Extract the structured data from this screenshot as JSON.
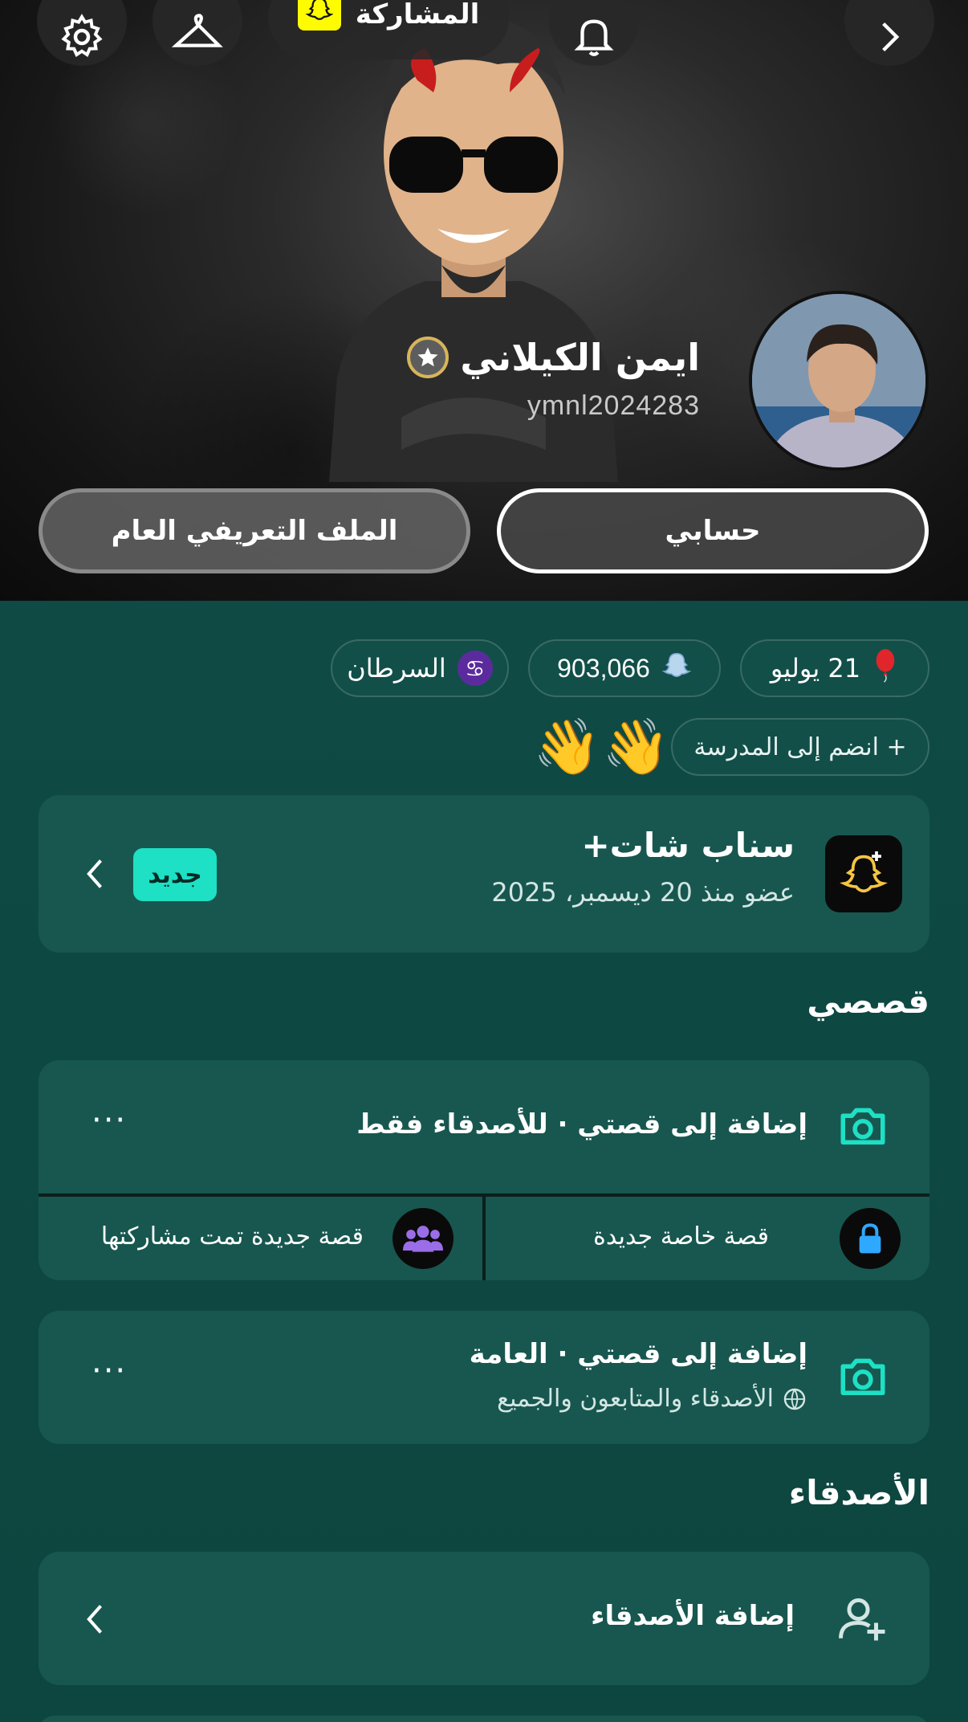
{
  "topbar": {
    "share_label": "المشاركة",
    "icons": [
      "settings-icon",
      "outfit-hanger-icon",
      "snapcode-icon",
      "notification-bell-icon",
      "chevron-right-icon"
    ]
  },
  "profile": {
    "display_name": "ايمن الكيلاني",
    "username": "ymnl2024283"
  },
  "hero_buttons": {
    "my_account": "حسابي",
    "public_profile": "الملف التعريفي العام"
  },
  "chips": {
    "birthday": "21 يوليو",
    "snap_score": "903,066",
    "zodiac": "السرطان",
    "join_school": "+ انضم إلى المدرسة"
  },
  "snapchat_plus": {
    "title": "سناب شات+",
    "subtitle": "عضو منذ 20 ديسمبر، 2025",
    "badge": "جديد"
  },
  "stories_section": {
    "title": "قصصي",
    "friends_only": "إضافة إلى قصتي · للأصدقاء فقط",
    "new_private_story": "قصة خاصة جديدة",
    "new_shared_story": "قصة جديدة تمت مشاركتها",
    "public_story": "إضافة إلى قصتي · العامة",
    "public_story_sub": "الأصدقاء والمتابعون والجميع"
  },
  "friends_section": {
    "title": "الأصدقاء",
    "add_friends": "إضافة الأصدقاء"
  },
  "colors": {
    "teal_bg": "#0f4a44",
    "card": "#17574f",
    "accent_teal": "#1de0c4",
    "snap_yellow": "#fffc00"
  }
}
